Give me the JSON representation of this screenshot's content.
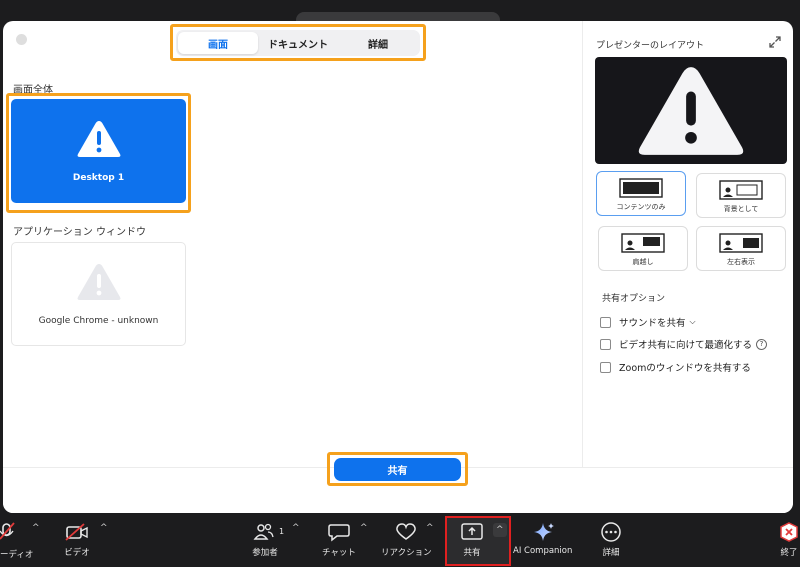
{
  "tabs": {
    "items": [
      {
        "label": "画面",
        "active": true
      },
      {
        "label": "ドキュメント",
        "active": false
      },
      {
        "label": "詳細",
        "active": false
      }
    ]
  },
  "left": {
    "screen_section_label": "画面全体",
    "desktop_tile_label": "Desktop 1",
    "app_section_label": "アプリケーション ウィンドウ",
    "app_tile_label": "Google Chrome - unknown"
  },
  "right": {
    "title": "プレゼンターのレイアウト",
    "layouts": [
      {
        "label": "コンテンツのみ",
        "selected": true
      },
      {
        "label": "背景として",
        "selected": false
      },
      {
        "label": "肩越し",
        "selected": false
      },
      {
        "label": "左右表示",
        "selected": false
      }
    ],
    "options_title": "共有オプション",
    "options": [
      {
        "label": "サウンドを共有",
        "checked": false
      },
      {
        "label": "ビデオ共有に向けて最適化する",
        "checked": false
      },
      {
        "label": "Zoomのウィンドウを共有する",
        "checked": false
      }
    ]
  },
  "share_button_label": "共有",
  "toolbar": {
    "audio_label": "ーディオ",
    "video_label": "ビデオ",
    "participants_label": "参加者",
    "participants_count": "1",
    "chat_label": "チャット",
    "reactions_label": "リアクション",
    "share_label": "共有",
    "ai_label": "AI Companion",
    "more_label": "詳細",
    "end_label": "終了"
  },
  "colors": {
    "accent": "#0e72ed",
    "highlight": "#f5a11c",
    "active_outline": "#e02020",
    "toolbar_bg": "#1c1c1e"
  }
}
